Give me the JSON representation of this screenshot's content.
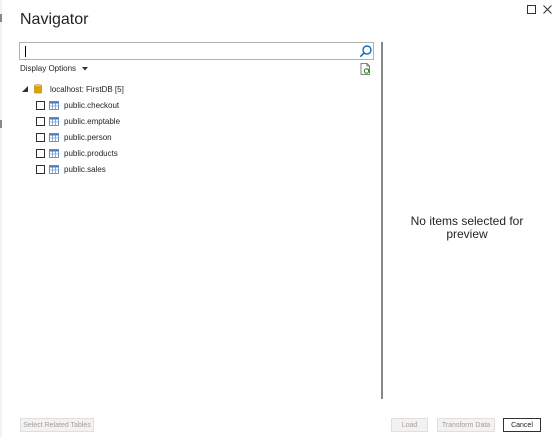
{
  "window": {
    "title": "Navigator"
  },
  "search": {
    "value": "",
    "placeholder": ""
  },
  "toolbar": {
    "display_options_label": "Display Options"
  },
  "tree": {
    "root": {
      "label": "localhost: FirstDB [5]",
      "expanded": true
    },
    "items": [
      {
        "label": "public.checkout",
        "checked": false
      },
      {
        "label": "public.emptable",
        "checked": false
      },
      {
        "label": "public.person",
        "checked": false
      },
      {
        "label": "public.products",
        "checked": false
      },
      {
        "label": "public.sales",
        "checked": false
      }
    ]
  },
  "preview": {
    "message": "No items selected for preview"
  },
  "footer": {
    "select_related_label": "Select Related Tables",
    "load_label": "Load",
    "transform_label": "Transform Data",
    "cancel_label": "Cancel"
  },
  "colors": {
    "accent": "#0f6cbd",
    "db_icon": "#d9a400",
    "table_icon": "#4a7ebb",
    "splitter": "#8a8886",
    "disabled_text": "#a19f9d"
  }
}
